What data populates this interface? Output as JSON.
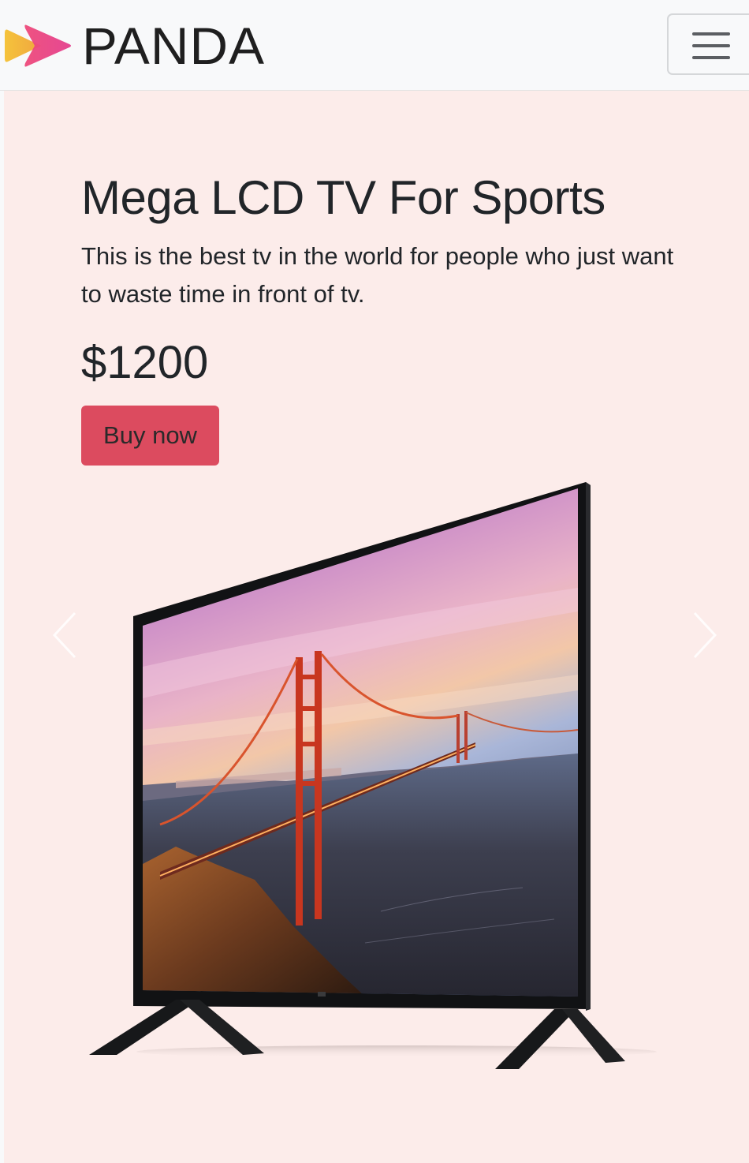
{
  "navbar": {
    "brand_name": "PANDA",
    "brand_logo_icon": "play-chevron-logo-icon",
    "menu_icon": "hamburger-menu-icon",
    "colors": {
      "logo_back": "#f7c23a",
      "logo_front": "#ea4483",
      "background": "#f8f9fa"
    }
  },
  "hero": {
    "title": "Mega LCD TV For Sports",
    "description": "This is the best tv in the world for people who just want to waste time in front of tv.",
    "price": "$1200",
    "buy_button_label": "Buy now",
    "colors": {
      "background": "#fcecea",
      "button": "#dc4b5f"
    }
  },
  "carousel": {
    "image_alt": "LCD TV showing Golden Gate Bridge at sunset",
    "prev_icon": "chevron-left-icon",
    "next_icon": "chevron-right-icon"
  }
}
